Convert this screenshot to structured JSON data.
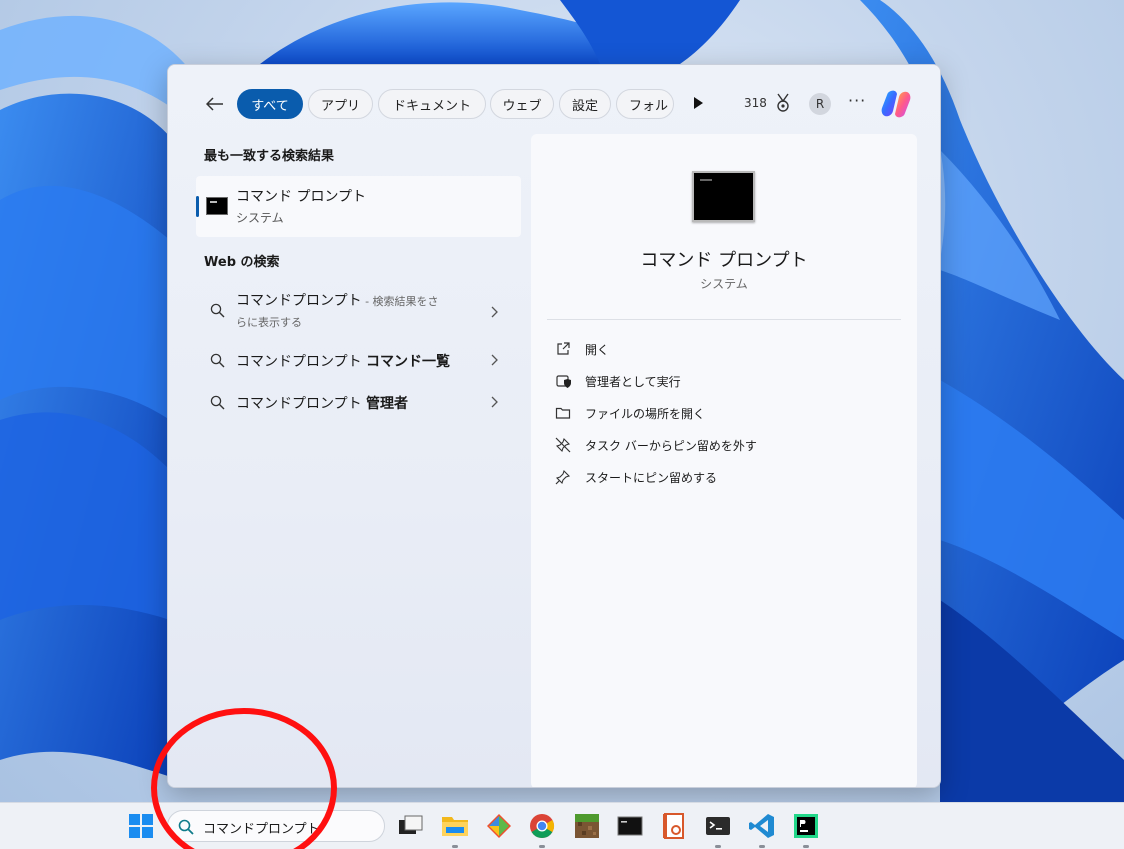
{
  "flyout": {
    "filters": [
      "すべて",
      "アプリ",
      "ドキュメント",
      "ウェブ",
      "設定",
      "フォル"
    ],
    "active_filter": "すべて",
    "points": "318",
    "avatar_letter": "R",
    "more_label": "···"
  },
  "results": {
    "best_match_heading": "最も一致する検索結果",
    "best_match": {
      "title": "コマンド プロンプト",
      "subtitle": "システム"
    },
    "web_heading": "Web の検索",
    "web_items": [
      {
        "query": "コマンドプロンプト",
        "hint_line1": " - 検索結果をさ",
        "hint_line2": "らに表示する"
      },
      {
        "query": "コマンドプロンプト ",
        "bold": "コマンド一覧"
      },
      {
        "query": "コマンドプロンプト ",
        "bold": "管理者"
      }
    ]
  },
  "detail": {
    "name": "コマンド プロンプト",
    "kind": "システム",
    "actions": [
      "開く",
      "管理者として実行",
      "ファイルの場所を開く",
      "タスク バーからピン留めを外す",
      "スタートにピン留めする"
    ]
  },
  "taskbar": {
    "search_value": "コマンドプロンプト",
    "apps": [
      "task-view",
      "file-explorer",
      "git",
      "chrome",
      "minecraft",
      "command-prompt",
      "office",
      "terminal",
      "vscode",
      "pycharm"
    ]
  },
  "colors": {
    "accent": "#0a5cad",
    "annotation": "#ff1010"
  }
}
